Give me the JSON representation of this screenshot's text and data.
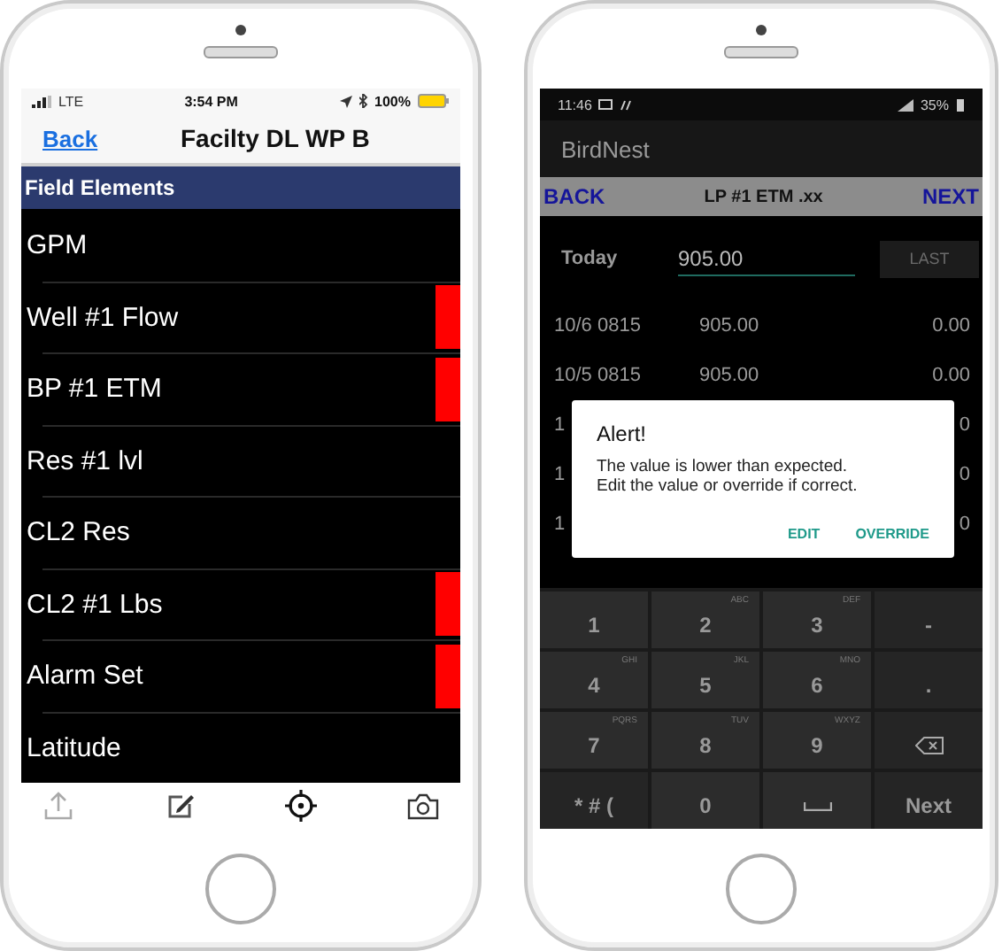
{
  "ios_screen": {
    "status_bar": {
      "network": "LTE",
      "time": "3:54 PM",
      "battery": "100%"
    },
    "nav_bar": {
      "back": "Back",
      "title": "Facilty DL WP B"
    },
    "section_header": "Field Elements",
    "items": [
      {
        "label": "GPM",
        "flagged": false
      },
      {
        "label": "Well #1 Flow",
        "flagged": true
      },
      {
        "label": "BP #1 ETM",
        "flagged": true
      },
      {
        "label": "Res #1 lvl",
        "flagged": false
      },
      {
        "label": "CL2 Res",
        "flagged": false
      },
      {
        "label": "CL2 #1 Lbs",
        "flagged": true
      },
      {
        "label": "Alarm Set",
        "flagged": true
      },
      {
        "label": "Latitude",
        "flagged": false
      }
    ]
  },
  "android_screen": {
    "status_bar": {
      "time": "11:46",
      "battery": "35%"
    },
    "app_title": "BirdNest",
    "nav_bar": {
      "back": "BACK",
      "title": "LP #1 ETM .xx",
      "next": "NEXT"
    },
    "entry": {
      "label": "Today",
      "value": "905.00",
      "button": "LAST",
      "button_disabled": true
    },
    "history": [
      {
        "date": "10/6 0815",
        "value": "905.00",
        "change": "0.00"
      },
      {
        "date": "10/5 0815",
        "value": "905.00",
        "change": "0.00"
      },
      {
        "date": "1",
        "change": "0"
      },
      {
        "date": "1",
        "change": "0"
      },
      {
        "date": "1",
        "change": "0"
      }
    ],
    "dialog": {
      "title": "Alert!",
      "message": "The value is lower than expected.\nEdit the value or override if correct.",
      "buttons": [
        "EDIT",
        "OVERRIDE"
      ]
    },
    "keypad": [
      {
        "kind": "char",
        "main": "1"
      },
      {
        "kind": "char",
        "main": "2",
        "letters": "ABC"
      },
      {
        "kind": "char",
        "main": "3",
        "letters": "DEF"
      },
      {
        "kind": "symbol",
        "main": "-"
      },
      {
        "kind": "char",
        "main": "4",
        "letters": "GHI"
      },
      {
        "kind": "char",
        "main": "5",
        "letters": "JKL"
      },
      {
        "kind": "char",
        "main": "6",
        "letters": "MNO"
      },
      {
        "kind": "symbol",
        "main": "."
      },
      {
        "kind": "char",
        "main": "7",
        "letters": "PQRS"
      },
      {
        "kind": "char",
        "main": "8",
        "letters": "TUV"
      },
      {
        "kind": "char",
        "main": "9",
        "letters": "WXYZ"
      },
      {
        "kind": "backspace"
      },
      {
        "kind": "symbol",
        "main": "* # ("
      },
      {
        "kind": "char",
        "main": "0"
      },
      {
        "kind": "space"
      },
      {
        "kind": "action",
        "main": "Next"
      }
    ]
  }
}
